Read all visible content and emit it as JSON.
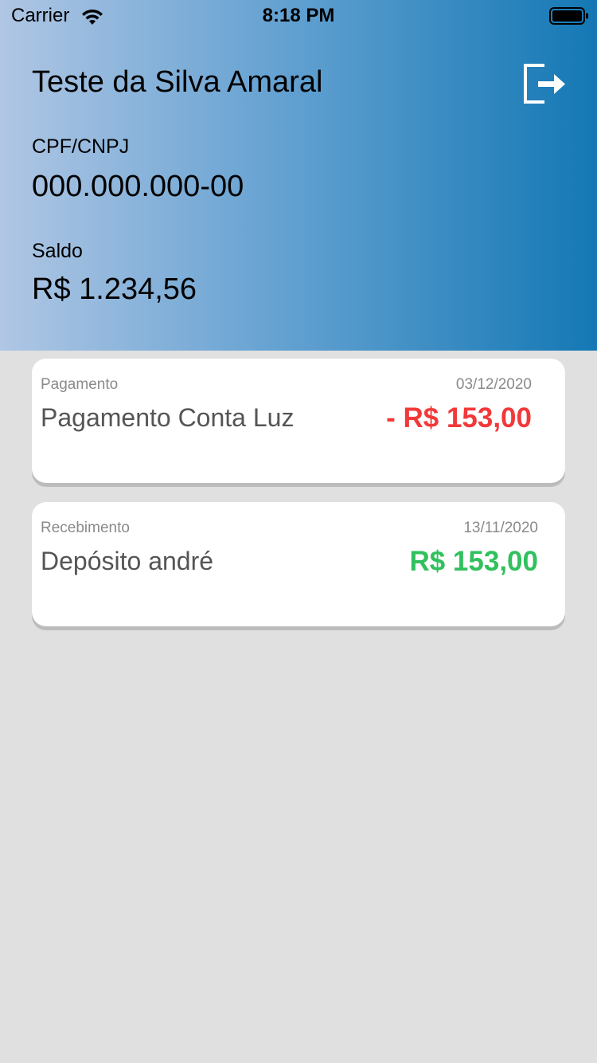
{
  "status_bar": {
    "carrier": "Carrier",
    "time": "8:18 PM"
  },
  "header": {
    "user_name": "Teste da Silva Amaral",
    "document_label": "CPF/CNPJ",
    "document_value": "000.000.000-00",
    "balance_label": "Saldo",
    "balance_value": "R$ 1.234,56",
    "logout_icon": "logout-icon"
  },
  "transactions": [
    {
      "type": "Pagamento",
      "date": "03/12/2020",
      "description": "Pagamento Conta Luz",
      "amount": "- R$ 153,00",
      "amount_color": "#f2393a"
    },
    {
      "type": "Recebimento",
      "date": "13/11/2020",
      "description": "Depósito andré",
      "amount": "R$ 153,00",
      "amount_color": "#31c05d"
    }
  ],
  "colors": {
    "background": "#e0e0e0",
    "gradient_start": "#b0c6e4",
    "gradient_end": "#1478b4",
    "negative": "#f2393a",
    "positive": "#31c05d"
  }
}
